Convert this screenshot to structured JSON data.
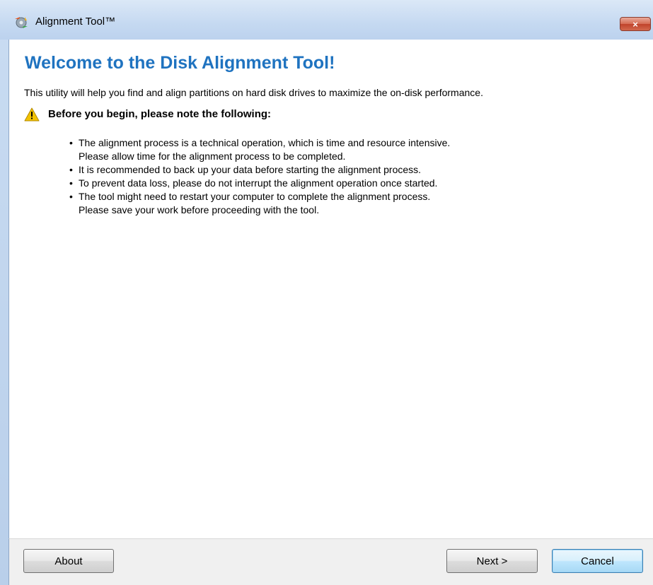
{
  "window": {
    "title": "Alignment Tool™",
    "close_label": "×",
    "app_icon": "disk-alignment-app-icon"
  },
  "content": {
    "heading": "Welcome to the Disk Alignment Tool!",
    "intro": "This utility will help you find and align partitions on hard disk drives to maximize the on-disk performance.",
    "warning_icon": "warning-triangle-icon",
    "warning_title": "Before you begin, please note the following:",
    "notes": [
      "The alignment process is a technical operation, which is time and resource intensive.",
      "Please allow time for the alignment process to be completed.",
      "It is recommended to back up your data before starting the alignment process.",
      "To prevent data loss, please do not interrupt the alignment operation once started.",
      "The tool might need to restart your computer to complete the alignment process.",
      "Please save your work before proceeding with the tool."
    ]
  },
  "footer": {
    "about_label": "About",
    "next_label": "Next >",
    "cancel_label": "Cancel"
  },
  "colors": {
    "heading": "#1f73c0",
    "warning": "#f2c200",
    "close_button": "#c0432b"
  }
}
